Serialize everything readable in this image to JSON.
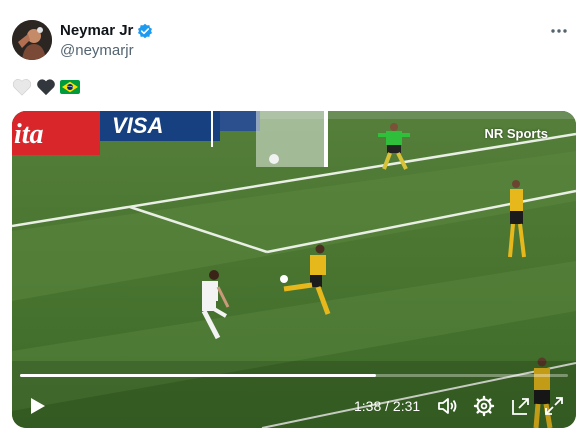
{
  "author": {
    "display_name": "Neymar Jr",
    "handle": "@neymarjr",
    "verified": true
  },
  "more_icon": "more-horizontal-icon",
  "post_text_emojis": [
    "white-heart-icon",
    "black-heart-icon",
    "brazil-flag-icon"
  ],
  "video": {
    "watermark": "NR Sports",
    "current_time": "1:38",
    "duration": "2:31",
    "time_display": "1:38 / 2:31",
    "progress_fraction": 0.649,
    "ad_boards": [
      "ita",
      "VISA"
    ],
    "controls": [
      "play-icon",
      "volume-icon",
      "settings-gear-icon",
      "picture-in-picture-icon",
      "fullscreen-icon"
    ]
  },
  "colors": {
    "verified_blue": "#1d9bf0",
    "handle_gray": "#536471",
    "pitch_green": "#4c7a35"
  }
}
